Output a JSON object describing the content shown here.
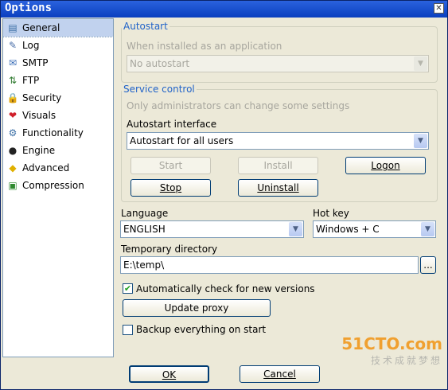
{
  "window": {
    "title": "Options",
    "close": "✕"
  },
  "nav": {
    "items": [
      {
        "label": "General",
        "icon": "general-icon",
        "glyph": "▤",
        "color": "#3a6ea5"
      },
      {
        "label": "Log",
        "icon": "log-icon",
        "glyph": "✎",
        "color": "#4a6fa8"
      },
      {
        "label": "SMTP",
        "icon": "smtp-icon",
        "glyph": "✉",
        "color": "#356ab5"
      },
      {
        "label": "FTP",
        "icon": "ftp-icon",
        "glyph": "⇅",
        "color": "#2f7a2f"
      },
      {
        "label": "Security",
        "icon": "lock-icon",
        "glyph": "🔒",
        "color": "#c08a00"
      },
      {
        "label": "Visuals",
        "icon": "heart-icon",
        "glyph": "❤",
        "color": "#d01f2a"
      },
      {
        "label": "Functionality",
        "icon": "functionality-icon",
        "glyph": "⚙",
        "color": "#3a6ea5"
      },
      {
        "label": "Engine",
        "icon": "engine-icon",
        "glyph": "●",
        "color": "#222"
      },
      {
        "label": "Advanced",
        "icon": "cube-icon",
        "glyph": "◆",
        "color": "#e0b000"
      },
      {
        "label": "Compression",
        "icon": "compression-icon",
        "glyph": "▣",
        "color": "#2f8a2f"
      }
    ]
  },
  "autostart": {
    "legend": "Autostart",
    "hint": "When installed as an application",
    "value": "No autostart"
  },
  "service": {
    "legend": "Service control",
    "hint": "Only administrators can change some settings",
    "interface_label": "Autostart interface",
    "interface_value": "Autostart for all users",
    "start": "Start",
    "install": "Install",
    "logon": "Logon",
    "stop": "Stop",
    "uninstall": "Uninstall"
  },
  "language": {
    "label": "Language",
    "value": "ENGLISH"
  },
  "hotkey": {
    "label": "Hot key",
    "value": "Windows + C"
  },
  "tempdir": {
    "label": "Temporary directory",
    "value": "E:\\temp\\",
    "browse": "..."
  },
  "check_versions": {
    "label": "Automatically check for new versions",
    "checked": true
  },
  "update_proxy": "Update proxy",
  "backup": {
    "label": "Backup everything on start",
    "checked": false
  },
  "footer": {
    "ok": "OK",
    "cancel": "Cancel"
  },
  "watermark": {
    "line1": "51CTO.com",
    "line2": "技术成就梦想"
  }
}
